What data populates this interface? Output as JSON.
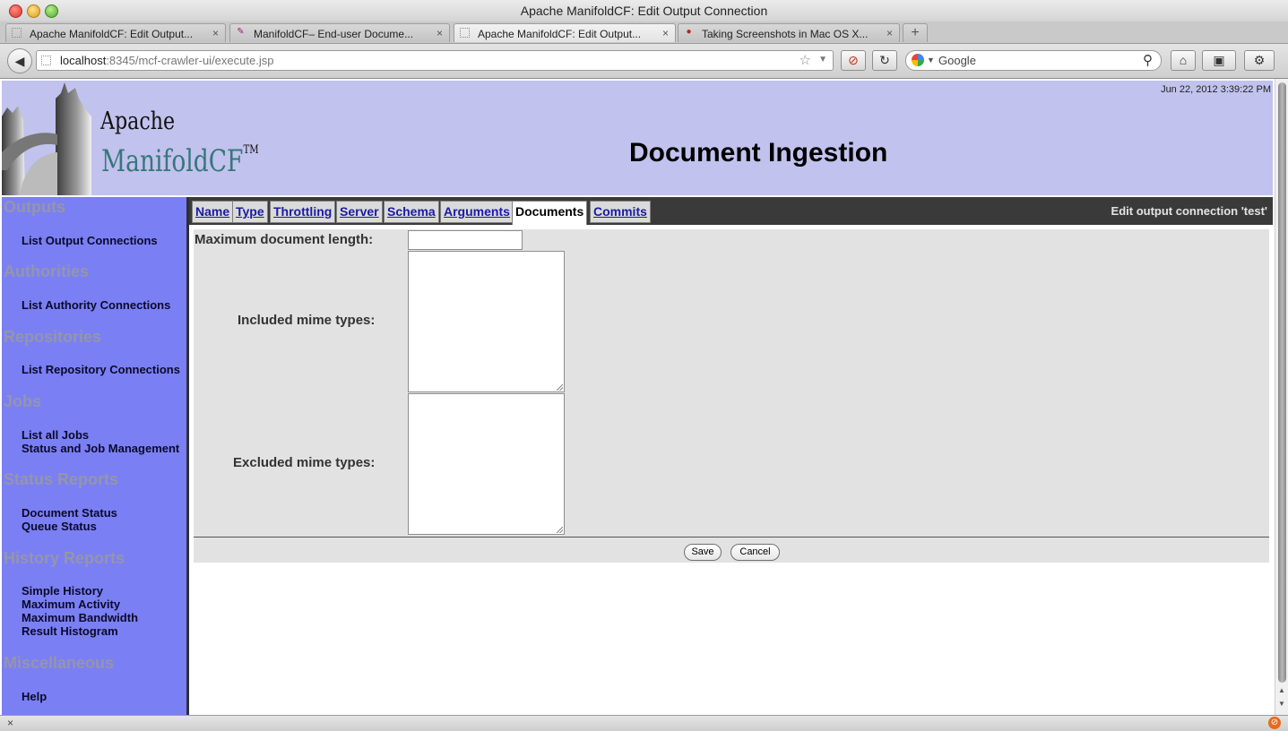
{
  "window": {
    "title": "Apache ManifoldCF: Edit Output Connection"
  },
  "browser_tabs": [
    {
      "label": "Apache ManifoldCF: Edit Output...",
      "close": "×",
      "fav": ""
    },
    {
      "label": "ManifoldCF– End-user Docume...",
      "close": "×",
      "fav": "✎"
    },
    {
      "label": "Apache ManifoldCF: Edit Output...",
      "close": "×",
      "fav": ""
    },
    {
      "label": "Taking Screenshots in Mac OS X...",
      "close": "×",
      "fav": ""
    }
  ],
  "new_tab": "+",
  "address": {
    "host": "localhost",
    "rest": ":8345/mcf-crawler-ui/execute.jsp"
  },
  "search": {
    "placeholder": "Google"
  },
  "icons": {
    "back": "◀",
    "star": "☆",
    "dropdown": "▼",
    "stop": "⊘",
    "reload": "↻",
    "magnifier": "⚲",
    "home": "⌂",
    "bookmarks": "▣",
    "addon": "⚙",
    "status_close": "×",
    "scroll_up": "▲",
    "scroll_down": "▼"
  },
  "banner": {
    "logo_line1": "Apache",
    "logo_line2": "ManifoldCF",
    "logo_tm": "TM",
    "timestamp": "Jun 22, 2012 3:39:22 PM",
    "title": "Document Ingestion"
  },
  "sidebar": {
    "sections": [
      {
        "heading": "Outputs",
        "links": [
          "List Output Connections"
        ]
      },
      {
        "heading": "Authorities",
        "links": [
          "List Authority Connections"
        ]
      },
      {
        "heading": "Repositories",
        "links": [
          "List Repository Connections"
        ]
      },
      {
        "heading": "Jobs",
        "links": [
          "List all Jobs",
          "Status and Job Management"
        ]
      },
      {
        "heading": "Status Reports",
        "links": [
          "Document Status",
          "Queue Status"
        ]
      },
      {
        "heading": "History Reports",
        "links": [
          "Simple History",
          "Maximum Activity",
          "Maximum Bandwidth",
          "Result Histogram"
        ]
      },
      {
        "heading": "Miscellaneous",
        "links": [
          "Help"
        ]
      }
    ]
  },
  "tabs": [
    {
      "label": "Name"
    },
    {
      "label": "Type"
    },
    {
      "label": "Throttling"
    },
    {
      "label": "Server"
    },
    {
      "label": "Schema"
    },
    {
      "label": "Arguments"
    },
    {
      "label": "Documents",
      "active": true
    },
    {
      "label": "Commits"
    }
  ],
  "edit_label": "Edit output connection 'test'",
  "form": {
    "max_length_label": "Maximum document length:",
    "max_length_value": "",
    "included_label": "Included mime types:",
    "included_value": "",
    "excluded_label": "Excluded mime types:",
    "excluded_value": "",
    "save": "Save",
    "cancel": "Cancel"
  },
  "colors": {
    "banner": "#c2c2ee",
    "sidebar": "#7b7ff4",
    "form_bg": "#e2e2e2",
    "tab_bar": "#3a3a3a",
    "link": "#1a1aa6",
    "logo_teal": "#37777a"
  }
}
